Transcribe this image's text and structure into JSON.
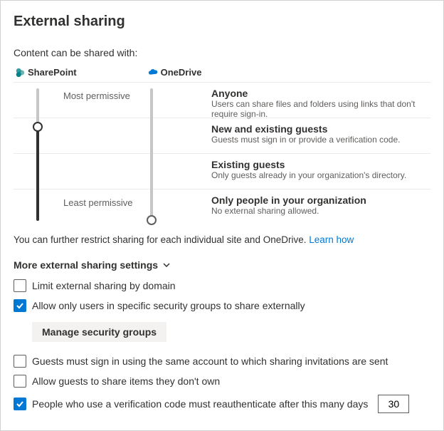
{
  "title": "External sharing",
  "subtitle": "Content can be shared with:",
  "products": {
    "sharepoint": "SharePoint",
    "onedrive": "OneDrive"
  },
  "sliderLabels": {
    "most": "Most permissive",
    "least": "Least permissive"
  },
  "options": [
    {
      "title": "Anyone",
      "sub": "Users can share files and folders using links that don't require sign-in."
    },
    {
      "title": "New and existing guests",
      "sub": "Guests must sign in or provide a verification code."
    },
    {
      "title": "Existing guests",
      "sub": "Only guests already in your organization's directory."
    },
    {
      "title": "Only people in your organization",
      "sub": "No external sharing allowed."
    }
  ],
  "note": {
    "text": "You can further restrict sharing for each individual site and OneDrive. ",
    "link": "Learn how"
  },
  "moreHeader": "More external sharing settings",
  "settings": {
    "limitDomain": "Limit external sharing by domain",
    "allowGroups": "Allow only users in specific security groups to share externally",
    "manageBtn": "Manage security groups",
    "sameAccount": "Guests must sign in using the same account to which sharing invitations are sent",
    "shareNotOwn": "Allow guests to share items they don't own",
    "reauth": "People who use a verification code must reauthenticate after this many days",
    "reauthDays": "30"
  }
}
